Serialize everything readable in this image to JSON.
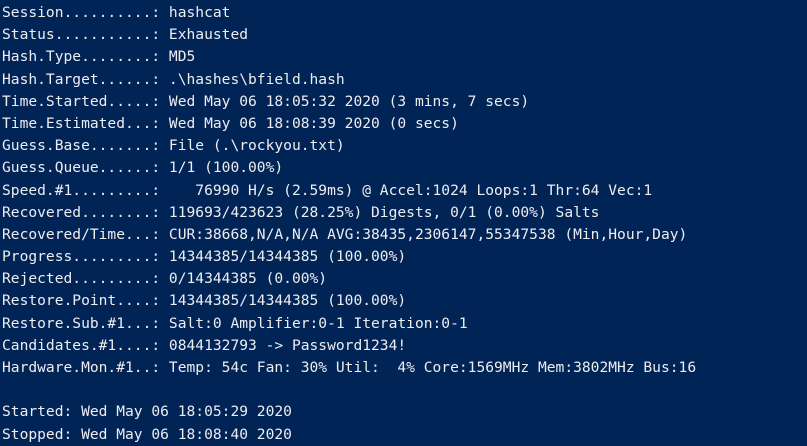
{
  "status_lines": [
    "Session..........: hashcat",
    "Status...........: Exhausted",
    "Hash.Type........: MD5",
    "Hash.Target......: .\\hashes\\bfield.hash",
    "Time.Started.....: Wed May 06 18:05:32 2020 (3 mins, 7 secs)",
    "Time.Estimated...: Wed May 06 18:08:39 2020 (0 secs)",
    "Guess.Base.......: File (.\\rockyou.txt)",
    "Guess.Queue......: 1/1 (100.00%)",
    "Speed.#1.........:    76990 H/s (2.59ms) @ Accel:1024 Loops:1 Thr:64 Vec:1",
    "Recovered........: 119693/423623 (28.25%) Digests, 0/1 (0.00%) Salts",
    "Recovered/Time...: CUR:38668,N/A,N/A AVG:38435,2306147,55347538 (Min,Hour,Day)",
    "Progress.........: 14344385/14344385 (100.00%)",
    "Rejected.........: 0/14344385 (0.00%)",
    "Restore.Point....: 14344385/14344385 (100.00%)",
    "Restore.Sub.#1...: Salt:0 Amplifier:0-1 Iteration:0-1",
    "Candidates.#1....: 0844132793 -> Password1234!",
    "Hardware.Mon.#1..: Temp: 54c Fan: 30% Util:  4% Core:1569MHz Mem:3802MHz Bus:16"
  ],
  "footer_lines": [
    "Started: Wed May 06 18:05:29 2020",
    "Stopped: Wed May 06 18:08:40 2020"
  ],
  "colors": {
    "background": "#012456",
    "text": "#eeedf0"
  }
}
